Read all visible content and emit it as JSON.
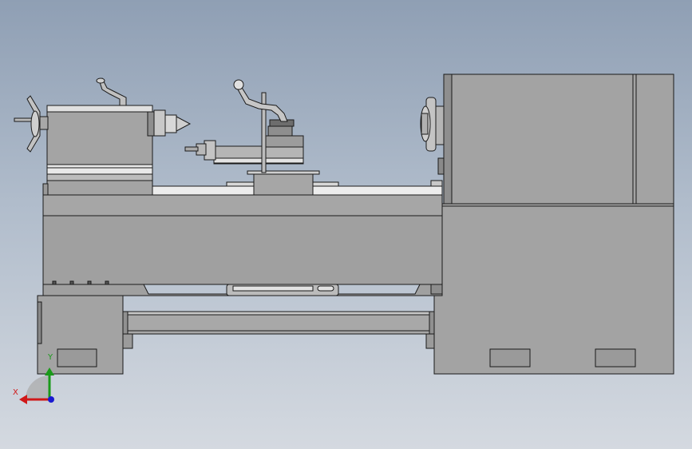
{
  "view": {
    "colors": {
      "background_top": "#8f9fb4",
      "background_bottom": "#d4d9e0",
      "part_fill": "#9e9e9e",
      "part_light": "#d0d0d0",
      "edge": "#1a1a1a"
    }
  },
  "triad": {
    "x_label": "X",
    "y_label": "Y",
    "x_color": "#d01818",
    "y_color": "#1a9a1a",
    "z_color": "#1a1ad0"
  }
}
